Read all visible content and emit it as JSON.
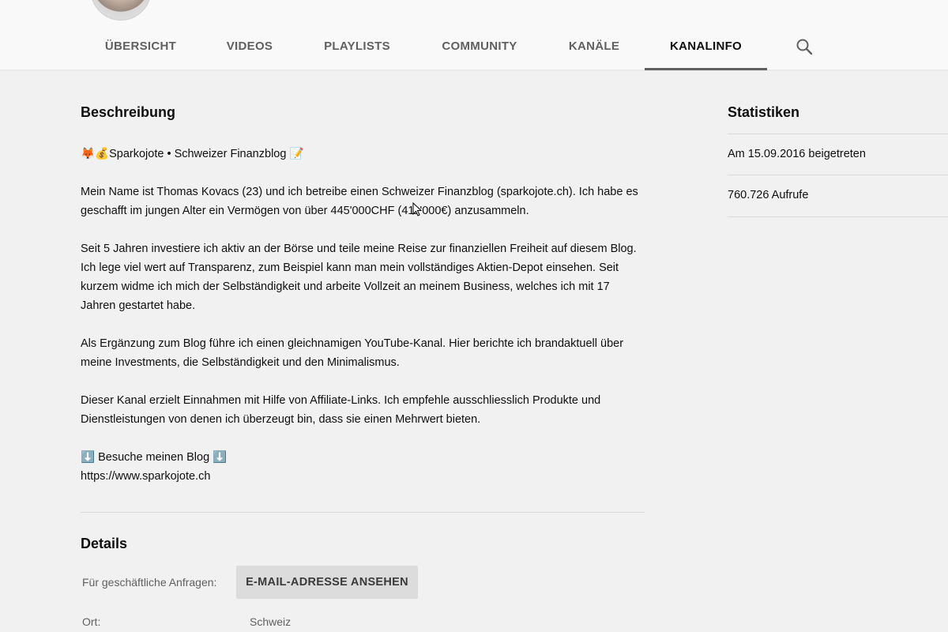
{
  "tabs": [
    {
      "label": "ÜBERSICHT"
    },
    {
      "label": "VIDEOS"
    },
    {
      "label": "PLAYLISTS"
    },
    {
      "label": "COMMUNITY"
    },
    {
      "label": "KANÄLE"
    },
    {
      "label": "KANALINFO",
      "active": true
    }
  ],
  "search_icon": "search-icon",
  "description": {
    "title": "Beschreibung",
    "headline_emojis_before": "🦊💰",
    "headline": "Sparkojote • Schweizer Finanzblog",
    "headline_emoji_after": "📝",
    "paragraphs": [
      "Mein Name ist Thomas Kovacs (23) und ich betreibe einen Schweizer Finanzblog (sparkojote.ch). Ich habe es geschafft im jungen Alter ein Vermögen von über 445'000CHF (411'000€) anzusammeln.",
      "Seit 5 Jahren investiere ich aktiv an der Börse und teile meine Reise zur finanziellen Freiheit auf diesem Blog. Ich lege viel wert auf Transparenz, zum Beispiel kann man mein vollständiges Aktien-Depot einsehen. Seit kurzem widme ich mich der Selbständigkeit und arbeite Vollzeit an meinem Business, welches ich mit 17 Jahren gestartet habe.",
      "Als Ergänzung zum Blog führe ich einen gleichnamigen YouTube-Kanal. Hier berichte ich brandaktuell über meine Investments, die Selbständigkeit und den Minimalismus.",
      "Dieser Kanal erzielt Einnahmen mit Hilfe von Affiliate-Links. Ich empfehle ausschliesslich Produkte und Dienstleistungen von denen ich überzeugt bin, dass sie einen Mehrwert bieten."
    ],
    "blog_arrow": "⬇️",
    "blog_label": "Besuche meinen Blog",
    "blog_url": "https://www.sparkojote.ch"
  },
  "details": {
    "title": "Details",
    "business_label": "Für geschäftliche Anfragen:",
    "email_button": "E-MAIL-ADRESSE ANSEHEN",
    "location_label": "Ort:",
    "location_value": "Schweiz"
  },
  "stats": {
    "title": "Statistiken",
    "joined": "Am 15.09.2016 beigetreten",
    "views": "760.726 Aufrufe"
  }
}
